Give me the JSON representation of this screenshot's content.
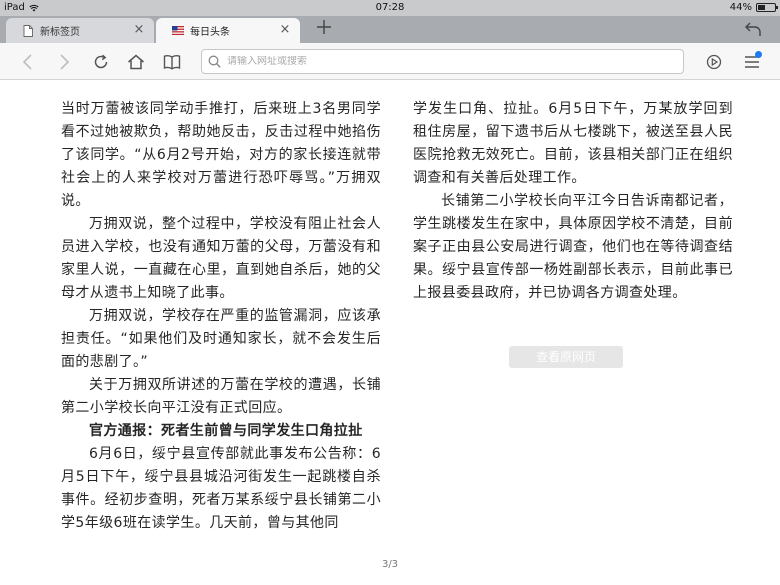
{
  "status_bar": {
    "device": "iPad",
    "time": "07:28",
    "battery_text": "44%",
    "battery_level": 0.44
  },
  "tabs": [
    {
      "label": "新标签页",
      "active": false
    },
    {
      "label": "每日头条",
      "active": true
    }
  ],
  "toolbar": {
    "url_placeholder": "请输入网址或搜索",
    "url_value": ""
  },
  "article": {
    "left_paragraphs": [
      {
        "text": "当时万蕾被该同学动手推打，后来班上3名男同学看不过她被欺负，帮助她反击，反击过程中她掐伤了该同学。“从6月2号开始，对方的家长接连就带社会上的人来学校对万蕾进行恐吓辱骂。”万拥双说。",
        "style": "plain"
      },
      {
        "text": "万拥双说，整个过程中，学校没有阻止社会人员进入学校，也没有通知万蕾的父母，万蕾没有和家里人说，一直藏在心里，直到她自杀后，她的父母才从遗书上知晓了此事。",
        "style": "indent"
      },
      {
        "text": "万拥双说，学校存在严重的监管漏洞，应该承担责任。“如果他们及时通知家长，就不会发生后面的悲剧了。”",
        "style": "indent"
      },
      {
        "text": "关于万拥双所讲述的万蕾在学校的遭遇，长铺第二小学校长向平江没有正式回应。",
        "style": "indent"
      },
      {
        "text": "官方通报：死者生前曾与同学发生口角拉扯",
        "style": "heading"
      },
      {
        "text": "6月6日，绥宁县宣传部就此事发布公告称：6月5日下午，绥宁县县城沿河街发生一起跳楼自杀事件。经初步查明，死者万某系绥宁县长铺第二小学5年级6班在读学生。几天前，曾与其他同",
        "style": "indent"
      }
    ],
    "right_paragraphs": [
      {
        "text": "学发生口角、拉扯。6月5日下午，万某放学回到租住房屋，留下遗书后从七楼跳下，被送至县人民医院抢救无效死亡。目前，该县相关部门正在组织调查和有关善后处理工作。",
        "style": "plain"
      },
      {
        "text": "长铺第二小学校长向平江今日告诉南都记者，学生跳楼发生在家中，具体原因学校不清楚，目前案子正由县公安局进行调查，他们也在等待调查结果。绥宁县宣传部一杨姓副部长表示，目前此事已上报县委县政府，并已协调各方调查处理。",
        "style": "indent"
      }
    ],
    "view_original_label": "查看原网页",
    "page_indicator": "3/3"
  },
  "icons": {
    "tab_new": "page-icon",
    "tab_daily": "flag-icon",
    "back": "chevron-left-icon",
    "forward": "chevron-right-icon",
    "reload": "reload-icon",
    "home": "home-icon",
    "bookmarks": "book-icon",
    "search": "search-icon",
    "play": "play-icon",
    "menu": "menu-icon",
    "undo": "undo-icon"
  },
  "colors": {
    "accent_dot": "#1a7cf0",
    "tab_bar": "#a8abb0",
    "toolbar": "#f7f7f7"
  }
}
